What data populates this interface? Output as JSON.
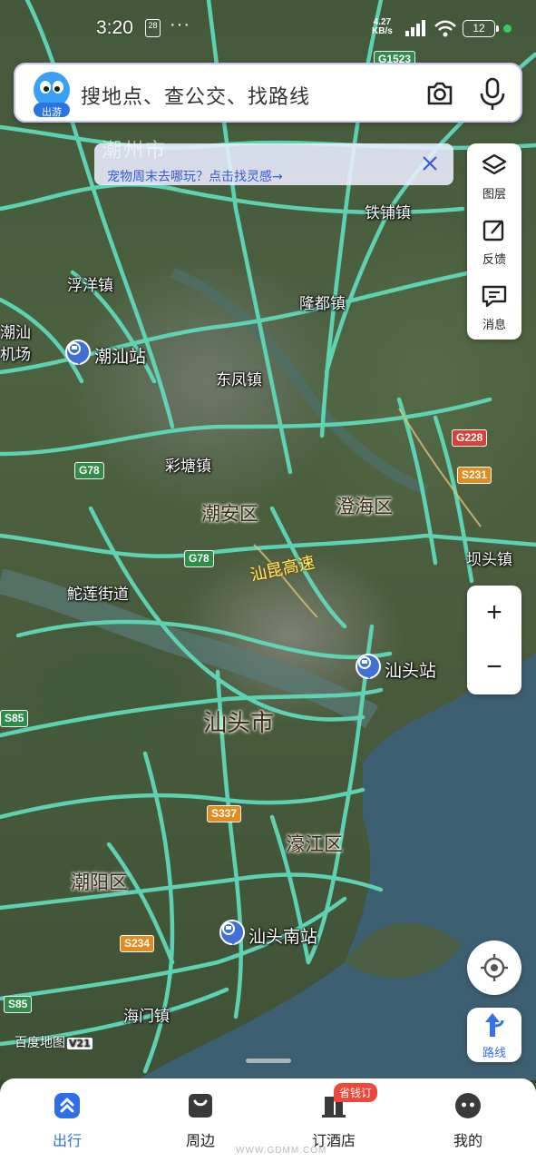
{
  "status_bar": {
    "time": "3:20",
    "badge": "28",
    "dots": "···",
    "net_speed_value": "4.27",
    "net_speed_unit": "KB/s",
    "battery": "12"
  },
  "search": {
    "logo_label": "出游",
    "placeholder": "搜地点、查公交、找路线",
    "camera_icon": "camera-icon",
    "mic_icon": "mic-icon"
  },
  "promo": {
    "ghost_text": "潮州市",
    "text": "宠物周末去哪玩？点击找灵感→"
  },
  "tools": {
    "layers_label": "图层",
    "feedback_label": "反馈",
    "messages_label": "消息"
  },
  "zoom": {
    "in_label": "+",
    "out_label": "−"
  },
  "route": {
    "label": "路线"
  },
  "map": {
    "towns": {
      "tiepu": "铁铺镇",
      "fuyang": "浮洋镇",
      "longdu": "隆都镇",
      "dongfeng": "东凤镇",
      "caitang": "彩塘镇",
      "bagtou": "坝头镇",
      "shelian": "鮀莲街道",
      "haimen": "海门镇",
      "chaoshan_airport_1": "潮汕",
      "chaoshan_airport_2": "机场"
    },
    "districts": {
      "chaoan": "潮安区",
      "chenghai": "澄海区",
      "haojiang": "濠江区",
      "chaoyang": "潮阳区"
    },
    "city": "汕头市",
    "stations": {
      "chaoshan": "潮汕站",
      "shantou": "汕头站",
      "shantou_south": "汕头南站"
    },
    "expressway": "汕昆高速",
    "shields": {
      "g1523": "G1523",
      "g78_a": "G78",
      "g78_b": "G78",
      "g228": "G228",
      "s231": "S231",
      "s85_a": "S85",
      "s85_b": "S85",
      "s337": "S337",
      "s234": "S234"
    },
    "watermark": "百度地图",
    "watermark_version": "V21",
    "road_color": "#5fd9b9",
    "water_color": "#3d5f72"
  },
  "nav": {
    "items": [
      {
        "label": "出行",
        "icon": "travel-icon"
      },
      {
        "label": "周边",
        "icon": "nearby-icon"
      },
      {
        "label": "订酒店",
        "icon": "hotel-icon"
      },
      {
        "label": "我的",
        "icon": "profile-icon"
      }
    ],
    "hotel_badge": "省钱订",
    "active_color": "#2f6ee9"
  },
  "footer_watermark": "WWW.GDMM.COM"
}
